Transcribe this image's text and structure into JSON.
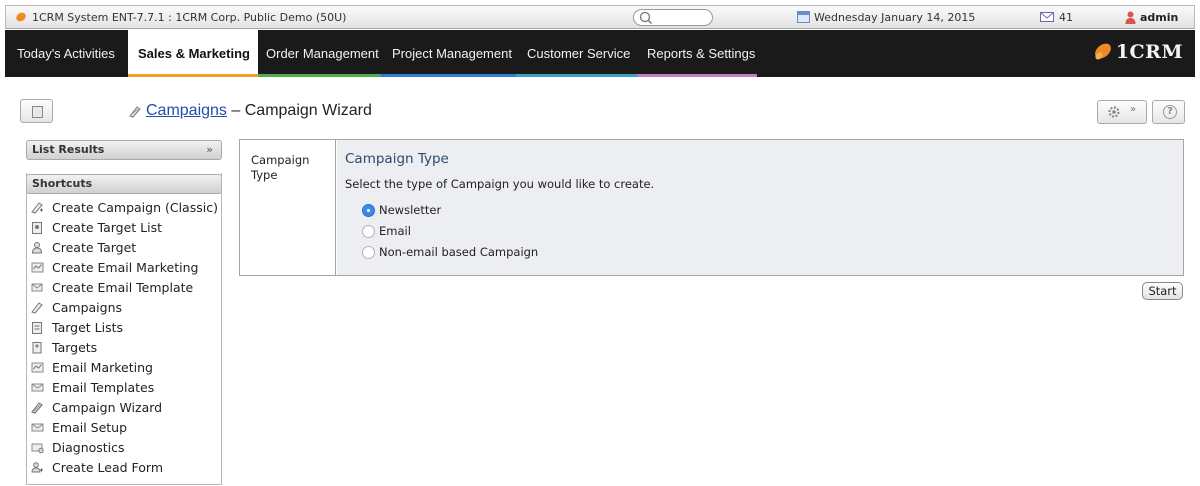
{
  "system_bar": {
    "title": "1CRM System ENT-7.7.1 : 1CRM Corp. Public Demo (50U)",
    "date": "Wednesday January 14, 2015",
    "mail_count": "41",
    "user": "admin"
  },
  "nav": {
    "tabs": [
      {
        "label": "Today's Activities",
        "accent": "#1a1a1a"
      },
      {
        "label": "Sales & Marketing",
        "accent": "#f0a020",
        "active": true
      },
      {
        "label": "Order Management",
        "accent": "#4caf50"
      },
      {
        "label": "Project Management",
        "accent": "#2e7dd6"
      },
      {
        "label": "Customer Service",
        "accent": "#3aa0c8"
      },
      {
        "label": "Reports & Settings",
        "accent": "#c27bc6"
      }
    ],
    "brand": "1CRM"
  },
  "breadcrumb": {
    "module": "Campaigns",
    "separator": "–",
    "page": "Campaign Wizard"
  },
  "sidebar": {
    "list_results": "List Results",
    "shortcuts_title": "Shortcuts",
    "items": [
      {
        "label": "Create Campaign (Classic)",
        "icon": "campaign-create-icon"
      },
      {
        "label": "Create Target List",
        "icon": "target-list-create-icon"
      },
      {
        "label": "Create Target",
        "icon": "target-create-icon"
      },
      {
        "label": "Create Email Marketing",
        "icon": "email-marketing-create-icon"
      },
      {
        "label": "Create Email Template",
        "icon": "email-template-create-icon"
      },
      {
        "label": "Campaigns",
        "icon": "campaigns-icon"
      },
      {
        "label": "Target Lists",
        "icon": "target-lists-icon"
      },
      {
        "label": "Targets",
        "icon": "targets-icon"
      },
      {
        "label": "Email Marketing",
        "icon": "email-marketing-icon"
      },
      {
        "label": "Email Templates",
        "icon": "email-templates-icon"
      },
      {
        "label": "Campaign Wizard",
        "icon": "campaign-wizard-icon"
      },
      {
        "label": "Email Setup",
        "icon": "email-setup-icon"
      },
      {
        "label": "Diagnostics",
        "icon": "diagnostics-icon"
      },
      {
        "label": "Create Lead Form",
        "icon": "lead-form-create-icon"
      }
    ]
  },
  "form": {
    "label": "Campaign Type",
    "heading": "Campaign Type",
    "description": "Select the type of Campaign you would like to create.",
    "options": [
      {
        "label": "Newsletter",
        "selected": true
      },
      {
        "label": "Email",
        "selected": false
      },
      {
        "label": "Non-email based Campaign",
        "selected": false
      }
    ],
    "start_label": "Start"
  }
}
